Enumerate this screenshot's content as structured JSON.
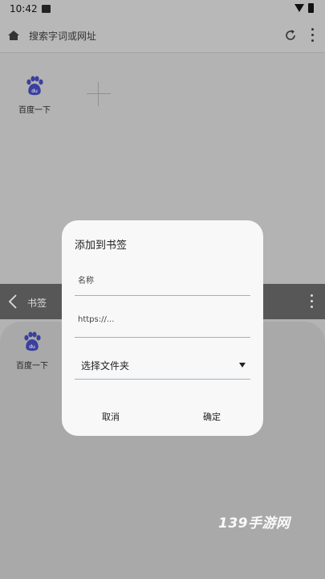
{
  "status_bar": {
    "time": "10:42"
  },
  "address_bar": {
    "placeholder": "搜索字词或网址"
  },
  "speed_dial": {
    "tiles": [
      {
        "label": "百度一下",
        "icon": "baidu-paw-icon"
      }
    ]
  },
  "bookmarks": {
    "title": "书签",
    "items": [
      {
        "label": "百度一下",
        "icon": "baidu-paw-icon"
      }
    ]
  },
  "dialog": {
    "title": "添加到书签",
    "name_placeholder": "名称",
    "url_placeholder": "https://...",
    "folder_select": "选择文件夹",
    "cancel_label": "取消",
    "confirm_label": "确定"
  },
  "watermark": "139手游网",
  "colors": {
    "accent_line": "#9ab3cc",
    "baidu_blue": "#3b3f9e",
    "overlay_gray": "#b3b3b3"
  }
}
